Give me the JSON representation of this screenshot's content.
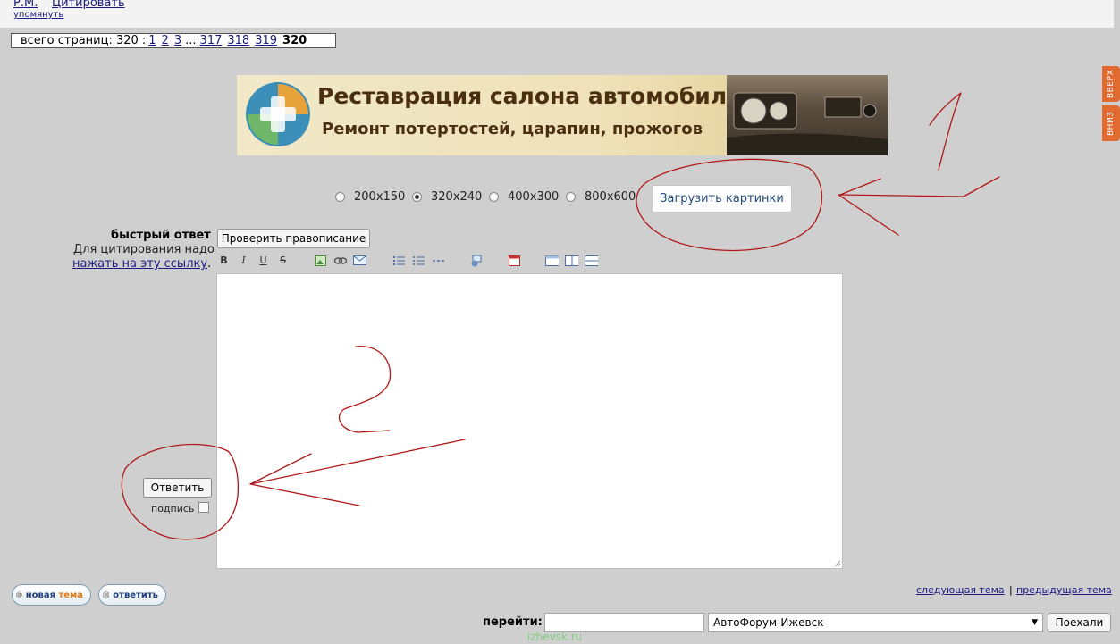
{
  "post": {
    "author": "Р.М.",
    "quote_link": "Цитировать",
    "mention_link": "упомянуть"
  },
  "pagination": {
    "label": "всего страниц: 320 :",
    "pages_start": [
      "1",
      "2",
      "3"
    ],
    "ellipsis": "...",
    "pages_end": [
      "317",
      "318",
      "319"
    ],
    "current": "320"
  },
  "banner": {
    "title": "Реставрация салона автомобиля",
    "subtitle": "Ремонт потертостей, царапин, прожогов"
  },
  "side_nav": {
    "up": "ВВЕРХ",
    "down": "ВНИЗ"
  },
  "image_sizes": {
    "options": [
      "200x150",
      "320x240",
      "400x300",
      "800x600"
    ],
    "selected": "320x240"
  },
  "upload_button": "Загрузить картинки",
  "quick_reply": {
    "title": "быстрый ответ",
    "hint": "Для цитирования надо",
    "hint_link": "нажать на эту ссылку",
    "hint_suffix": ".",
    "spellcheck_button": "Проверить правописание",
    "editor_value": "",
    "reply_button": "Ответить",
    "signature_label": "подпись",
    "signature_checked": false
  },
  "toolbar": {
    "icons": [
      "bold-icon",
      "italic-icon",
      "underline-icon",
      "strikethrough-icon",
      "image-icon",
      "link-icon",
      "email-icon",
      "ordered-list-icon",
      "unordered-list-icon",
      "horizontal-rule-icon",
      "spoiler-icon",
      "date-icon",
      "table-icon",
      "columns-icon",
      "divider-icon"
    ],
    "bold": "B",
    "italic": "I",
    "underline": "U",
    "strike": "S"
  },
  "bottom": {
    "new_topic_word1": "новая",
    "new_topic_word2": "тема",
    "reply_pill": "ответить",
    "next_topic": "следующая тема",
    "separator": "|",
    "prev_topic": "предыдущая тема"
  },
  "goto": {
    "label": "перейти:",
    "input_value": "",
    "selected_forum": "АвтоФорум-Ижевск",
    "go_button": "Поехали"
  },
  "watermark": "izhevsk.ru",
  "annotations": {
    "mark_1": "1",
    "mark_2": "2"
  },
  "colors": {
    "page_bg": "#cfcfcf",
    "annotation_red": "#b01818",
    "link": "#1a1a80"
  }
}
